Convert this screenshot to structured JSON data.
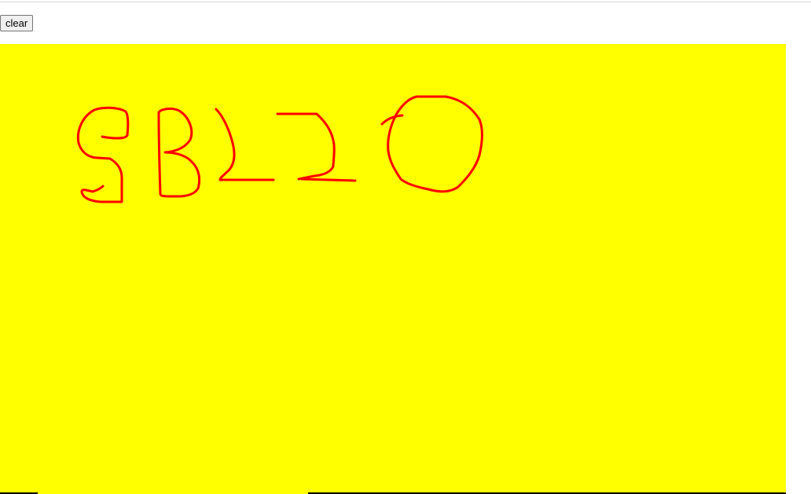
{
  "toolbar": {
    "clear_label": "clear"
  },
  "canvas": {
    "background_color": "#ffff00",
    "stroke_color": "#ff0000"
  }
}
